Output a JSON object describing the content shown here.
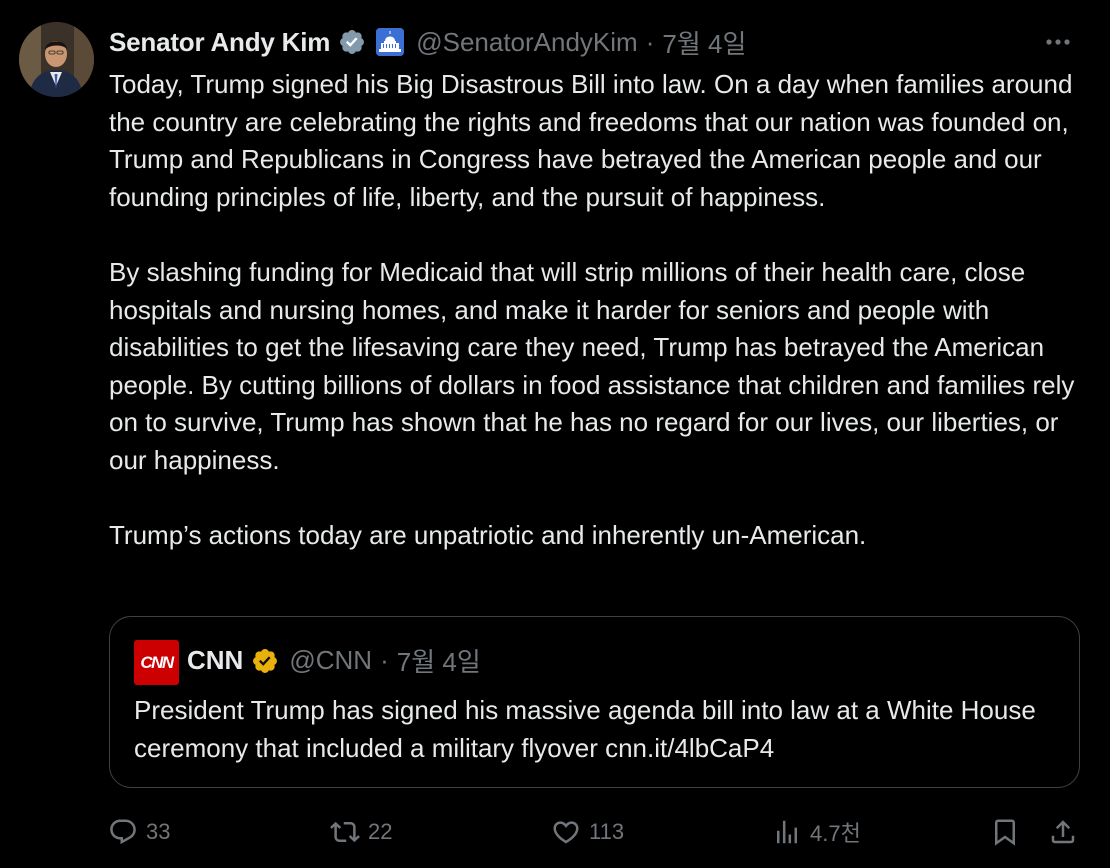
{
  "tweet": {
    "author": {
      "display_name": "Senator Andy Kim",
      "handle": "@SenatorAndyKim",
      "verified_badge": "gray-checkmark-badge-icon",
      "affiliation_icon": "capitol-building-icon"
    },
    "separator": "·",
    "date": "7월 4일",
    "more_icon": "more-horizontal-icon",
    "paragraphs": [
      "Today, Trump signed his Big Disastrous Bill into law. On a day when families around the country are celebrating the rights and freedoms that our nation was founded on, Trump and Republicans in Congress have betrayed the American people and our founding principles of life, liberty, and the pursuit of happiness.",
      "By slashing funding for Medicaid that will strip millions of their health care, close hospitals and nursing homes, and make it harder for seniors and people with disabilities to get the lifesaving care they need, Trump has betrayed the American people. By cutting billions of dollars in food assistance that children and families rely on to survive, Trump has shown that he has no regard for our lives, our liberties, or our happiness.",
      "Trump’s actions today are unpatriotic and inherently un-American."
    ],
    "quoted": {
      "avatar_text": "CNN",
      "display_name": "CNN",
      "verified_badge": "gold-checkmark-badge-icon",
      "handle": "@CNN",
      "separator": "·",
      "date": "7월 4일",
      "text": "President Trump has signed his massive agenda bill into law at a White House ceremony that included a military flyover cnn.it/4lbCaP4"
    },
    "actions": {
      "replies": "33",
      "reposts": "22",
      "likes": "113",
      "views": "4.7천"
    }
  },
  "colors": {
    "background": "#000000",
    "text_primary": "#e7e9ea",
    "text_secondary": "#71767b",
    "border": "#3e4144",
    "gold_badge": "#e9b10b",
    "gray_badge": "#829aab",
    "cnn_red": "#cc0000"
  }
}
